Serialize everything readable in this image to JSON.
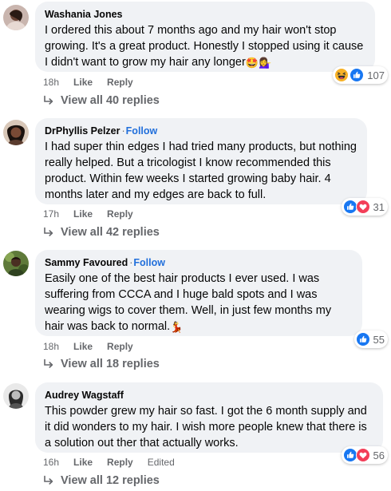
{
  "colors": {
    "bubble_bg": "#f0f2f5",
    "link_blue": "#216fdb",
    "meta_gray": "#65676b",
    "like_blue": "#1877f2",
    "love_red": "#f33e58",
    "haha_yellow": "#f7b125"
  },
  "comments": [
    {
      "author": "Washania Jones",
      "follow": "",
      "text": "I ordered this about 7 months ago and my hair won't stop growing. It's a great product. Honestly I stopped using it cause I didn't want to grow my hair any longer",
      "emojis": [
        "🤩",
        "💁‍♀️"
      ],
      "time": "18h",
      "like": "Like",
      "reply": "Reply",
      "edited": "",
      "reactions": [
        "haha-icon",
        "like-icon"
      ],
      "reaction_count": "107",
      "view_replies": "View all 40 replies"
    },
    {
      "author": "DrPhyllis Pelzer",
      "follow": "Follow",
      "text": "I had super thin edges I had tried many products, but nothing really helped. But a tricologist I know recommended this product. Within few weeks I started growing baby hair. 4 months later and my edges are back to full.",
      "emojis": [],
      "time": "17h",
      "like": "Like",
      "reply": "Reply",
      "edited": "",
      "reactions": [
        "like-icon",
        "love-icon"
      ],
      "reaction_count": "31",
      "view_replies": "View all 42 replies"
    },
    {
      "author": "Sammy Favoured",
      "follow": "Follow",
      "text": "Easily one of the best hair products I ever used. I was suffering from CCCA and I huge bald spots and I was wearing wigs to cover them. Well, in just few months my hair was back to normal.",
      "emojis": [
        "💃"
      ],
      "time": "18h",
      "like": "Like",
      "reply": "Reply",
      "edited": "",
      "reactions": [
        "like-icon"
      ],
      "reaction_count": "55",
      "view_replies": "View all 18 replies"
    },
    {
      "author": "Audrey Wagstaff",
      "follow": "",
      "text": "This powder grew my hair so fast. I got the 6 month supply and it did wonders to my hair. I wish more people knew that there is a solution out ther that actually works.",
      "emojis": [],
      "time": "16h",
      "like": "Like",
      "reply": "Reply",
      "edited": "Edited",
      "reactions": [
        "like-icon",
        "love-icon"
      ],
      "reaction_count": "56",
      "view_replies": "View all 12 replies"
    }
  ],
  "separator": "·"
}
